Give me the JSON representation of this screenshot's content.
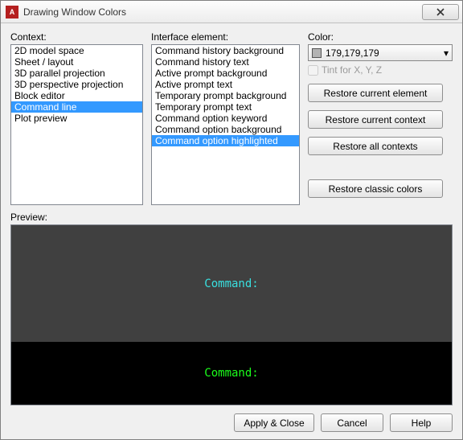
{
  "title": "Drawing Window Colors",
  "labels": {
    "context": "Context:",
    "element": "Interface element:",
    "color": "Color:",
    "tint": "Tint for X, Y, Z",
    "preview": "Preview:"
  },
  "context_items": [
    "2D model space",
    "Sheet / layout",
    "3D parallel projection",
    "3D perspective projection",
    "Block editor",
    "Command line",
    "Plot preview"
  ],
  "context_selected": 5,
  "element_items": [
    "Command history background",
    "Command history text",
    "Active prompt background",
    "Active prompt text",
    "Temporary prompt background",
    "Temporary prompt text",
    "Command option keyword",
    "Command option background",
    "Command option highlighted"
  ],
  "element_selected": 8,
  "color": {
    "label": "179,179,179",
    "rgb": "rgb(179,179,179)"
  },
  "buttons": {
    "restore_element": "Restore current element",
    "restore_context": "Restore current context",
    "restore_all": "Restore all contexts",
    "restore_classic": "Restore classic colors",
    "apply": "Apply & Close",
    "cancel": "Cancel",
    "help": "Help"
  },
  "preview": {
    "top_text": "Command:",
    "bottom_text": "Command:"
  }
}
